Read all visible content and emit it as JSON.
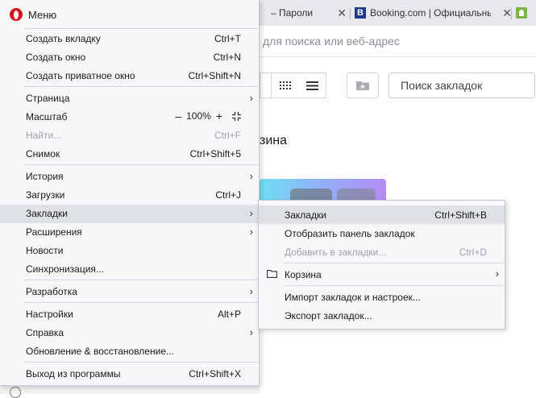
{
  "browser": {
    "tabs": [
      {
        "title": "– Пароли",
        "close": "✕"
      },
      {
        "title": "Booking.com | Официальный",
        "favicon": "B",
        "close": "✕"
      },
      {
        "title": "",
        "favicon": "android"
      }
    ],
    "address_placeholder": "для поиска или веб-адрес",
    "bookmark_search_placeholder": "Поиск закладок",
    "section_heading": "зина"
  },
  "menu": {
    "title": "Меню",
    "groups": [
      [
        {
          "label": "Создать вкладку",
          "shortcut": "Ctrl+T"
        },
        {
          "label": "Создать окно",
          "shortcut": "Ctrl+N"
        },
        {
          "label": "Создать приватное окно",
          "shortcut": "Ctrl+Shift+N"
        }
      ],
      [
        {
          "label": "Страница",
          "submenu": true
        },
        {
          "label": "Масштаб",
          "zoom": "100%"
        },
        {
          "label": "Найти...",
          "shortcut": "Ctrl+F",
          "disabled": true
        },
        {
          "label": "Снимок",
          "shortcut": "Ctrl+Shift+5"
        }
      ],
      [
        {
          "label": "История",
          "submenu": true
        },
        {
          "label": "Загрузки",
          "shortcut": "Ctrl+J"
        },
        {
          "label": "Закладки",
          "submenu": true,
          "highlighted": true
        },
        {
          "label": "Расширения",
          "submenu": true
        },
        {
          "label": "Новости"
        },
        {
          "label": "Синхронизация..."
        }
      ],
      [
        {
          "label": "Разработка",
          "submenu": true
        }
      ],
      [
        {
          "label": "Настройки",
          "shortcut": "Alt+P"
        },
        {
          "label": "Справка",
          "submenu": true
        },
        {
          "label": "Обновление & восстановление..."
        }
      ],
      [
        {
          "label": "Выход из программы",
          "shortcut": "Ctrl+Shift+X"
        }
      ]
    ],
    "zoom": {
      "minus": "–",
      "value": "100%",
      "plus": "+"
    }
  },
  "submenu": {
    "items": [
      {
        "label": "Закладки",
        "shortcut": "Ctrl+Shift+B",
        "highlighted": true
      },
      {
        "label": "Отобразить панель закладок"
      },
      {
        "label": "Добавить в закладки...",
        "shortcut": "Ctrl+D",
        "disabled": true
      },
      {
        "label": "Корзина",
        "submenu": true,
        "icon": "folder-icon"
      },
      {
        "label": "Импорт закладок и настроек..."
      },
      {
        "label": "Экспорт закладок..."
      }
    ]
  },
  "colors": {
    "opera_red": "#d8141d",
    "highlight": "#dee1e6",
    "menu_bg": "#f6f7f9",
    "disabled_text": "#a0a3a8"
  }
}
